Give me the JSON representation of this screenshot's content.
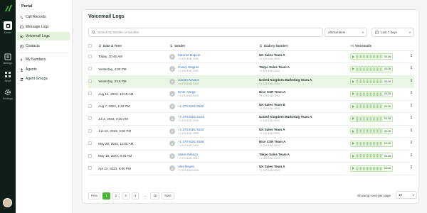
{
  "rail": {
    "items": [
      {
        "label": "Dialer",
        "icon": "dialer-icon"
      },
      {
        "label": "Billings",
        "icon": "billing-icon"
      },
      {
        "label": "Apps",
        "icon": "apps-icon"
      },
      {
        "label": "Settings",
        "icon": "settings-icon"
      }
    ]
  },
  "nav": {
    "title": "Portal",
    "items": [
      {
        "label": "Call Records",
        "icon": "phone-icon"
      },
      {
        "label": "Message Logs",
        "icon": "message-icon"
      },
      {
        "label": "Voicemail Logs",
        "icon": "voicemail-icon"
      },
      {
        "label": "Contacts",
        "icon": "contacts-icon"
      },
      {
        "label": "My Numbers",
        "icon": "numbers-icon"
      },
      {
        "label": "Agents",
        "icon": "agents-icon"
      },
      {
        "label": "Agent Groups",
        "icon": "groups-icon"
      }
    ],
    "active_index": 2
  },
  "page": {
    "title": "Voicemail Logs",
    "search_placeholder": "Search by Sender or Number",
    "filter_numbers": "All Numbers",
    "filter_range": "Last 7 days"
  },
  "table": {
    "headers": [
      "Date & Time",
      "Sender",
      "Dialory Number",
      "Voicemails"
    ],
    "rows": [
      {
        "date": "Today, 10:45 AM",
        "sender": "Maxime Dupont",
        "sender_number": "+1 470 8181 0000",
        "team": "UK Sales Team A",
        "team_number": "+1 123 8181 0000",
        "duration": "00:28",
        "highlight": false
      },
      {
        "date": "Yesterday, 4:30 PM",
        "sender": "Casey Wagner",
        "sender_number": "+1 470 8181 0000",
        "team": "Tokyo Sales Team A",
        "team_number": "+1 123 8181 0000",
        "duration": "00:28",
        "highlight": false
      },
      {
        "date": "Yesterday, 3:15 PM",
        "sender": "Jordan Kovacs",
        "sender_number": "+1 470 8181 0000",
        "team": "United Kingdom Marketing Team A",
        "team_number": "+1 123 8181 0000",
        "duration": "00:28",
        "highlight": true
      },
      {
        "date": "Aug 12, 2023, 10:15 AM",
        "sender": "Emeri Varga",
        "sender_number": "+1 470 8181 0000",
        "team": "Nice CSR Team A",
        "team_number": "+1 123 8181 0000",
        "duration": "00:28",
        "highlight": false
      },
      {
        "date": "Aug 7, 2023, 1:20 PM",
        "sender": "+1 470 8181 0500",
        "sender_number": "",
        "team": "UK Sales Team B",
        "team_number": "+1 123 8181 0000",
        "duration": "00:28",
        "highlight": false
      },
      {
        "date": "Jul 2, 2023, 9:30 AM",
        "sender": "+1 470 8181 8144",
        "sender_number": "+1 470 8181 0000",
        "team": "United Kingdom Marketing Team A",
        "team_number": "+1 123 8181 0000",
        "duration": "00:28",
        "highlight": false
      },
      {
        "date": "Jun 10, 2023, 3:00 PM",
        "sender": "+1 470 8181 8122",
        "sender_number": "+1 470 8181 0000",
        "team": "UK Sales Team A",
        "team_number": "+1 123 8181 0000",
        "duration": "00:28",
        "highlight": false
      },
      {
        "date": "May 20, 2023, 11:00 AM",
        "sender": "+1 470 8181 8166",
        "sender_number": "+1 470 8181 0000",
        "team": "Nice CSR Team A",
        "team_number": "+1 123 8181 0000",
        "duration": "00:28",
        "highlight": false
      },
      {
        "date": "May 18, 2023, 8:45 AM",
        "sender": "Jamie Nilsson",
        "sender_number": "+1 470 8181 0000",
        "team": "Tokyo Sales Team A",
        "team_number": "+1 123 8181 0000",
        "duration": "00:28",
        "highlight": false
      },
      {
        "date": "Apr 22, 2023, 6:00 PM",
        "sender": "Alex Reyes",
        "sender_number": "+1 470 8181 0000",
        "team": "UK Sales Team A",
        "team_number": "+1 123 8181 0000",
        "duration": "00:28",
        "highlight": false
      }
    ]
  },
  "pagination": {
    "prev": "Prev",
    "pages": [
      "1",
      "2",
      "3",
      "4",
      "...",
      "10"
    ],
    "active_page": "1",
    "next": "Next",
    "rows_label": "Showing rows per page",
    "rows_value": "10"
  },
  "colors": {
    "accent": "#49b83a",
    "rail": "#0f1f17",
    "link": "#2f6fbf",
    "highlight": "#e9f6e3"
  }
}
